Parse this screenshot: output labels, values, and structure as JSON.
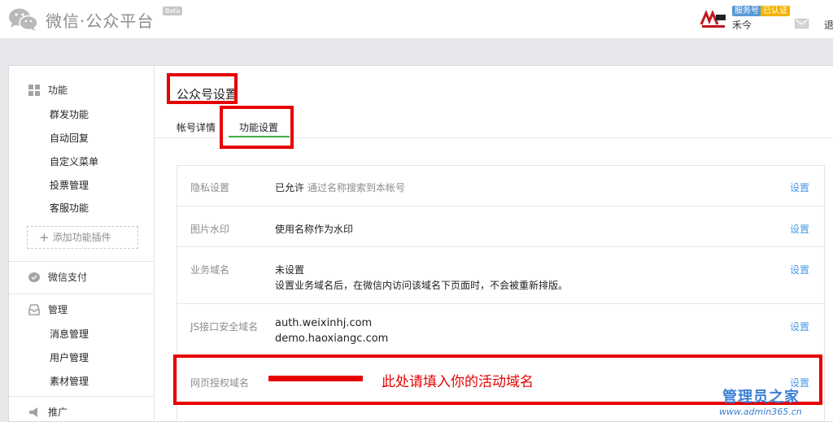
{
  "header": {
    "logo_text": "微信·公众平台",
    "beta": "Beta",
    "badge_service": "服务号",
    "badge_verified": "已认证",
    "username": "禾今",
    "logout": "退"
  },
  "sidebar": {
    "features": {
      "title": "功能",
      "items": [
        "群发功能",
        "自动回复",
        "自定义菜单",
        "投票管理",
        "客服功能"
      ],
      "add_plugin": "添加功能插件"
    },
    "payment": {
      "title": "微信支付"
    },
    "manage": {
      "title": "管理",
      "items": [
        "消息管理",
        "用户管理",
        "素材管理"
      ]
    },
    "promote": {
      "title": "推广"
    }
  },
  "content": {
    "page_title": "公众号设置",
    "tabs": [
      {
        "label": "帐号详情",
        "active": false
      },
      {
        "label": "功能设置",
        "active": true
      }
    ],
    "rows": [
      {
        "label": "隐私设置",
        "value": "已允许",
        "hint": "通过名称搜索到本帐号",
        "link": "设置"
      },
      {
        "label": "图片水印",
        "value": "使用名称作为水印",
        "link": "设置"
      },
      {
        "label": "业务域名",
        "value": "未设置",
        "value2": "设置业务域名后，在微信内访问该域名下页面时，不会被重新排版。",
        "link": "设置"
      },
      {
        "label": "JS接口安全域名",
        "value": "auth.weixinhj.com",
        "value2": "demo.haoxiangc.com",
        "link": "设置"
      },
      {
        "label": "网页授权域名",
        "link": "设置"
      }
    ]
  },
  "annotation": {
    "text": "此处请填入你的活动域名"
  },
  "watermark": {
    "title": "管理员之家",
    "url": "www.admin365.cn"
  },
  "colors": {
    "accent_green": "#44b549",
    "link_blue": "#459ae9",
    "annotation_red": "#e60000"
  }
}
